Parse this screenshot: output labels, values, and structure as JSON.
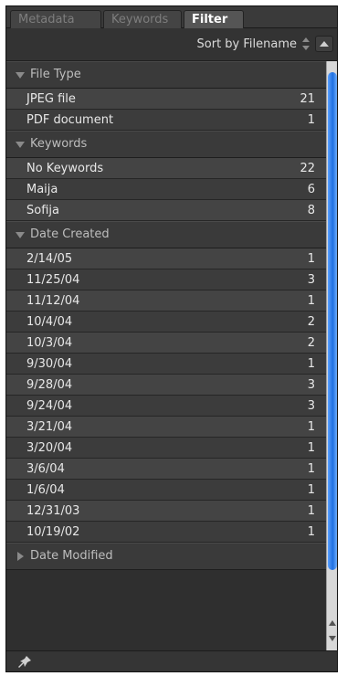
{
  "tabs": [
    {
      "label": "Metadata"
    },
    {
      "label": "Keywords"
    },
    {
      "label": "Filter"
    }
  ],
  "sort": {
    "label": "Sort by Filename"
  },
  "sections": {
    "file_type": {
      "title": "File Type",
      "items": [
        {
          "label": "JPEG file",
          "count": "21"
        },
        {
          "label": "PDF document",
          "count": "1"
        }
      ]
    },
    "keywords": {
      "title": "Keywords",
      "items": [
        {
          "label": "No Keywords",
          "count": "22"
        },
        {
          "label": "Maija",
          "count": "6"
        },
        {
          "label": "Sofija",
          "count": "8"
        }
      ]
    },
    "date_created": {
      "title": "Date Created",
      "items": [
        {
          "label": "2/14/05",
          "count": "1"
        },
        {
          "label": "11/25/04",
          "count": "3"
        },
        {
          "label": "11/12/04",
          "count": "1"
        },
        {
          "label": "10/4/04",
          "count": "2"
        },
        {
          "label": "10/3/04",
          "count": "2"
        },
        {
          "label": "9/30/04",
          "count": "1"
        },
        {
          "label": "9/28/04",
          "count": "3"
        },
        {
          "label": "9/24/04",
          "count": "3"
        },
        {
          "label": "3/21/04",
          "count": "1"
        },
        {
          "label": "3/20/04",
          "count": "1"
        },
        {
          "label": "3/6/04",
          "count": "1"
        },
        {
          "label": "1/6/04",
          "count": "1"
        },
        {
          "label": "12/31/03",
          "count": "1"
        },
        {
          "label": "10/19/02",
          "count": "1"
        }
      ]
    },
    "date_modified": {
      "title": "Date Modified"
    }
  },
  "icons": {
    "expanded": "triangle-down-icon",
    "collapsed": "triangle-right-icon",
    "sort": "sort-stepper-icon",
    "collapse_panel": "collapse-up-icon",
    "footer_tool": "pin-icon"
  },
  "colors": {
    "scroll_thumb": "#1f6fe0",
    "panel_bg": "#2c2c2c"
  }
}
